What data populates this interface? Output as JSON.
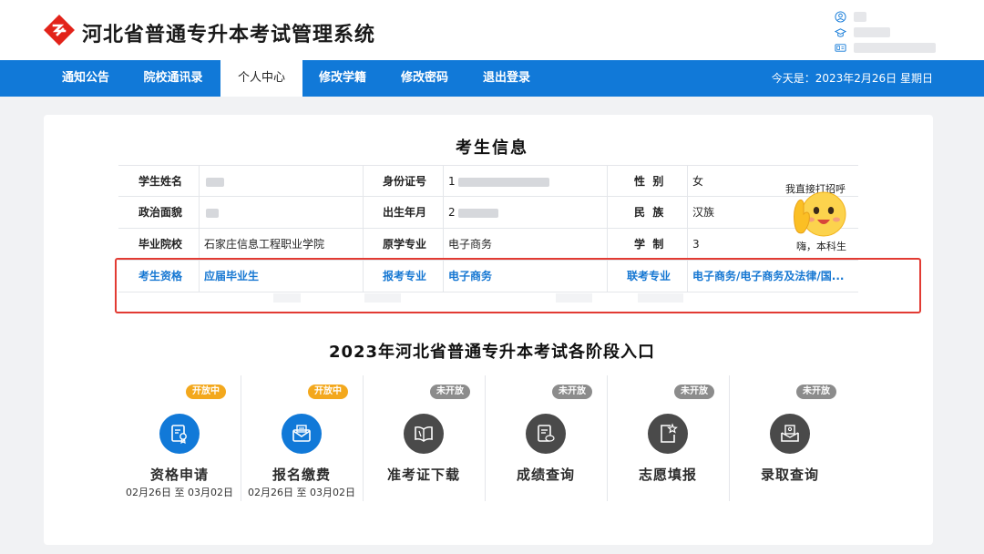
{
  "header": {
    "title": "河北省普通专升本考试管理系统"
  },
  "nav": {
    "items": [
      "通知公告",
      "院校通讯录",
      "个人中心",
      "修改学籍",
      "修改密码",
      "退出登录"
    ],
    "active_index": 2,
    "date": "今天是：2023年2月26日 星期日"
  },
  "info": {
    "title": "考生信息",
    "rows": [
      [
        {
          "label": "学生姓名",
          "value": ""
        },
        {
          "label": "身份证号",
          "value": "1"
        },
        {
          "label": "性  别",
          "value": "女"
        }
      ],
      [
        {
          "label": "政治面貌",
          "value": ""
        },
        {
          "label": "出生年月",
          "value": "2"
        },
        {
          "label": "民  族",
          "value": "汉族"
        }
      ],
      [
        {
          "label": "毕业院校",
          "value": "石家庄信息工程职业学院"
        },
        {
          "label": "原学专业",
          "value": "电子商务"
        },
        {
          "label": "学  制",
          "value": "3"
        }
      ],
      [
        {
          "label": "考生资格",
          "value": "应届毕业生"
        },
        {
          "label": "报考专业",
          "value": "电子商务"
        },
        {
          "label": "联考专业",
          "value": "电子商务/电子商务及法律/国..."
        }
      ]
    ]
  },
  "sticker": {
    "top_text": "我直接打招呼",
    "bottom_text": "嗨，本科生"
  },
  "stages": {
    "title": "2023年河北省普通专升本考试各阶段入口",
    "items": [
      {
        "name": "资格申请",
        "status": "开放中",
        "open": true,
        "dates": "02月26日 至 03月02日",
        "icon": "certificate-icon"
      },
      {
        "name": "报名缴费",
        "status": "开放中",
        "open": true,
        "dates": "02月26日 至 03月02日",
        "icon": "envelope-icon"
      },
      {
        "name": "准考证下载",
        "status": "未开放",
        "open": false,
        "dates": "",
        "icon": "book-icon"
      },
      {
        "name": "成绩查询",
        "status": "未开放",
        "open": false,
        "dates": "",
        "icon": "score-sheet-icon"
      },
      {
        "name": "志愿填报",
        "status": "未开放",
        "open": false,
        "dates": "",
        "icon": "star-form-icon"
      },
      {
        "name": "录取查询",
        "status": "未开放",
        "open": false,
        "dates": "",
        "icon": "admission-icon"
      }
    ]
  },
  "colors": {
    "primary": "#1179d8",
    "badge_open": "#f3a81d",
    "badge_closed": "#8c8c8c",
    "highlight": "#e23b33",
    "link": "#1677d2"
  }
}
